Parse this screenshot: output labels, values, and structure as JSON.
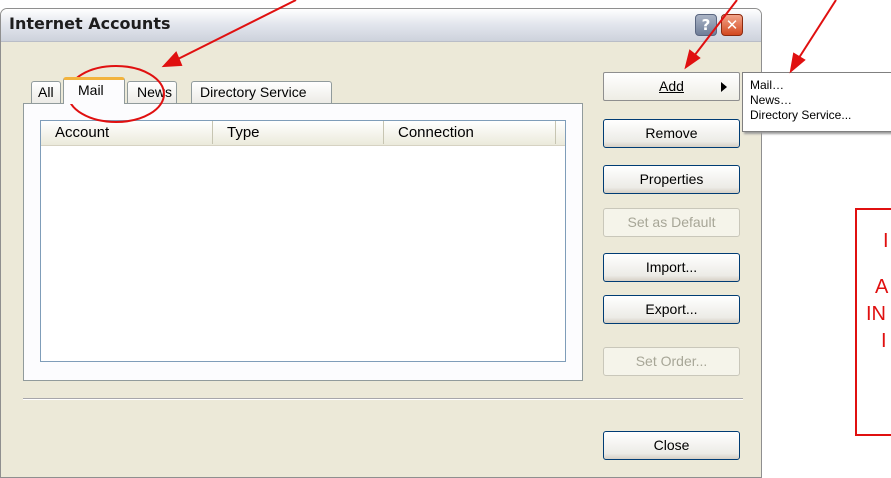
{
  "window": {
    "title": "Internet Accounts",
    "help_glyph": "?",
    "close_glyph": "✕"
  },
  "tabs": [
    {
      "label": "All"
    },
    {
      "label": "Mail"
    },
    {
      "label": "News"
    },
    {
      "label": "Directory Service"
    }
  ],
  "list": {
    "columns": [
      "Account",
      "Type",
      "Connection"
    ]
  },
  "buttons": {
    "add": "Add",
    "remove": "Remove",
    "properties": "Properties",
    "set_default": "Set as Default",
    "import": "Import...",
    "export": "Export...",
    "set_order": "Set Order...",
    "close": "Close"
  },
  "add_menu": {
    "items": [
      "Mail…",
      "News…",
      "Directory Service..."
    ]
  },
  "annotation": {
    "color": "#e01010",
    "visible_text": [
      "I",
      "A",
      "IN",
      "I"
    ]
  },
  "colors": {
    "dialog_bg": "#ece9d8",
    "tab_highlight": "#f2b33d",
    "button_border": "#003c74"
  }
}
